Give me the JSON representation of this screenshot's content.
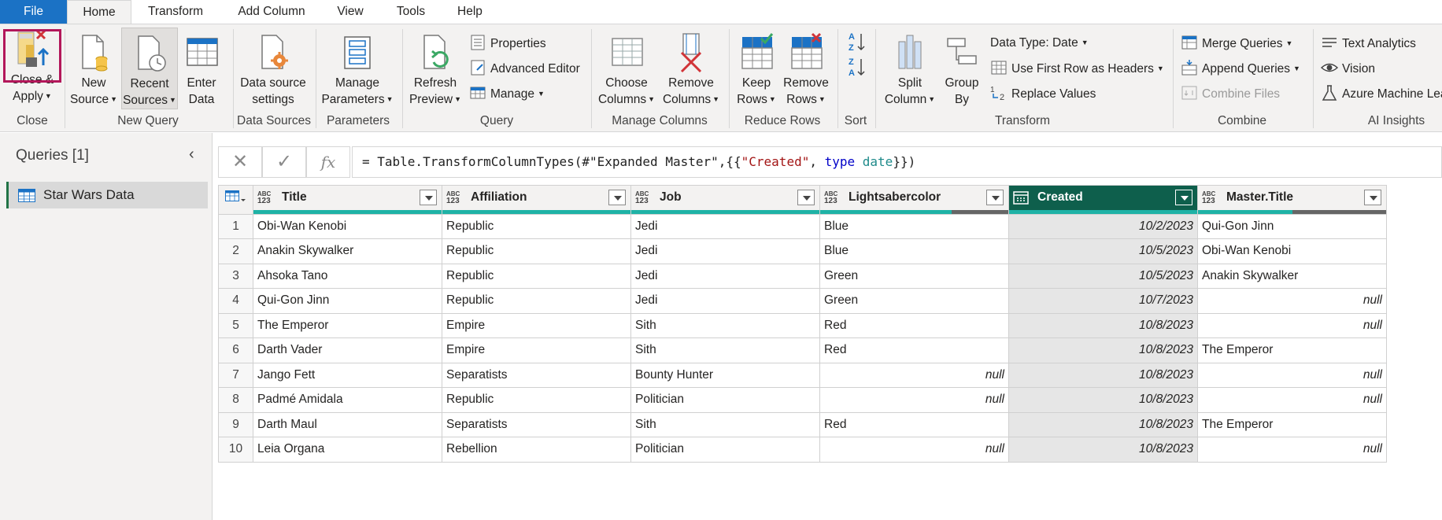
{
  "menu": {
    "file": "File",
    "tabs": [
      "Home",
      "Transform",
      "Add Column",
      "View",
      "Tools",
      "Help"
    ]
  },
  "ribbon": {
    "close": {
      "close_apply": [
        "Close &",
        "Apply"
      ],
      "group": "Close"
    },
    "new_query": {
      "new_source": [
        "New",
        "Source"
      ],
      "recent_sources": [
        "Recent",
        "Sources"
      ],
      "enter_data": [
        "Enter",
        "Data"
      ],
      "group": "New Query"
    },
    "data_sources": {
      "settings": [
        "Data source",
        "settings"
      ],
      "group": "Data Sources"
    },
    "parameters": {
      "manage": [
        "Manage",
        "Parameters"
      ],
      "group": "Parameters"
    },
    "query": {
      "refresh": [
        "Refresh",
        "Preview"
      ],
      "properties": "Properties",
      "advanced_editor": "Advanced Editor",
      "manage": "Manage",
      "group": "Query"
    },
    "manage_columns": {
      "choose": [
        "Choose",
        "Columns"
      ],
      "remove": [
        "Remove",
        "Columns"
      ],
      "group": "Manage Columns"
    },
    "reduce_rows": {
      "keep": [
        "Keep",
        "Rows"
      ],
      "remove": [
        "Remove",
        "Rows"
      ],
      "group": "Reduce Rows"
    },
    "sort": {
      "group": "Sort"
    },
    "transform": {
      "split": [
        "Split",
        "Column"
      ],
      "group_by": [
        "Group",
        "By"
      ],
      "data_type": "Data Type: Date",
      "first_row": "Use First Row as Headers",
      "replace": "Replace Values",
      "group": "Transform"
    },
    "combine": {
      "merge": "Merge Queries",
      "append": "Append Queries",
      "combine_files": "Combine Files",
      "group": "Combine"
    },
    "ai": {
      "text": "Text Analytics",
      "vision": "Vision",
      "azure": "Azure Machine Lea",
      "group": "AI Insights"
    }
  },
  "queries": {
    "title": "Queries [1]",
    "items": [
      "Star Wars Data"
    ]
  },
  "formula": {
    "prefix": "= Table.TransformColumnTypes(#\"Expanded Master\",{{",
    "str": "\"Created\"",
    "sep": ", ",
    "kw": "type",
    "sp": " ",
    "ty": "date",
    "suffix": "}})"
  },
  "colors": {
    "accent": "#1b72c5",
    "selected_header": "#0e5f4c",
    "quality_bar": "#1fb2a6",
    "close_highlight": "#b3175a"
  },
  "grid": {
    "headers": [
      {
        "type": "ABC 123",
        "name": "Title"
      },
      {
        "type": "ABC 123",
        "name": "Affiliation"
      },
      {
        "type": "ABC 123",
        "name": "Job"
      },
      {
        "type": "ABC 123",
        "name": "Lightsabercolor"
      },
      {
        "type": "calendar-icon",
        "name": "Created"
      },
      {
        "type": "ABC 123",
        "name": "Master.Title"
      }
    ],
    "quality_valid": [
      1,
      1,
      1,
      0.7,
      1,
      0.5
    ],
    "rows": [
      [
        "1",
        "Obi-Wan Kenobi",
        "Republic",
        "Jedi",
        "Blue",
        "10/2/2023",
        "Qui-Gon Jinn"
      ],
      [
        "2",
        "Anakin Skywalker",
        "Republic",
        "Jedi",
        "Blue",
        "10/5/2023",
        "Obi-Wan Kenobi"
      ],
      [
        "3",
        "Ahsoka Tano",
        "Republic",
        "Jedi",
        "Green",
        "10/5/2023",
        "Anakin Skywalker"
      ],
      [
        "4",
        "Qui-Gon Jinn",
        "Republic",
        "Jedi",
        "Green",
        "10/7/2023",
        "null"
      ],
      [
        "5",
        "The Emperor",
        "Empire",
        "Sith",
        "Red",
        "10/8/2023",
        "null"
      ],
      [
        "6",
        "Darth Vader",
        "Empire",
        "Sith",
        "Red",
        "10/8/2023",
        "The Emperor"
      ],
      [
        "7",
        "Jango Fett",
        "Separatists",
        "Bounty Hunter",
        "null",
        "10/8/2023",
        "null"
      ],
      [
        "8",
        "Padmé Amidala",
        "Republic",
        "Politician",
        "null",
        "10/8/2023",
        "null"
      ],
      [
        "9",
        "Darth Maul",
        "Separatists",
        "Sith",
        "Red",
        "10/8/2023",
        "The Emperor"
      ],
      [
        "10",
        "Leia Organa",
        "Rebellion",
        "Politician",
        "null",
        "10/8/2023",
        "null"
      ]
    ]
  }
}
